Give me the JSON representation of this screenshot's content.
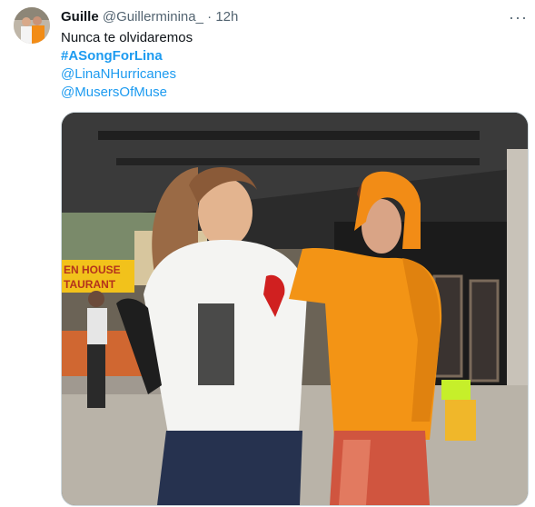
{
  "tweet": {
    "author_name": "Guille",
    "author_handle": "@Guillerminina_",
    "separator": "·",
    "timestamp": "12h",
    "more_icon": "more-horizontal-icon",
    "text_line": "Nunca te olvidaremos",
    "hashtag": "#ASongForLina",
    "mentions": [
      "@LinaNHurricanes",
      "@MusersOfMuse"
    ],
    "photo": {
      "sign_text": [
        "EN HOUSE",
        "TAURANT"
      ]
    }
  }
}
